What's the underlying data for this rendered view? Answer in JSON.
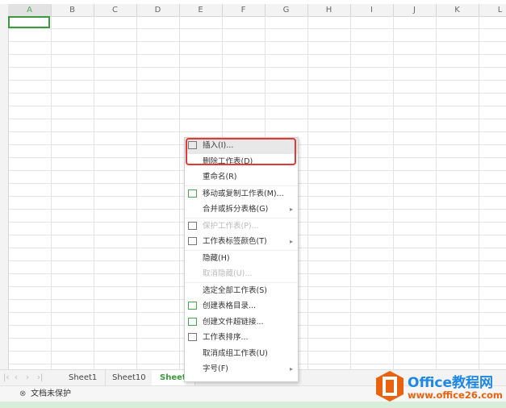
{
  "columns": [
    "A",
    "B",
    "C",
    "D",
    "E",
    "F",
    "G",
    "H",
    "I",
    "J",
    "K",
    "L"
  ],
  "sheet_tabs": [
    "Sheet1",
    "Sheet10",
    "Sheet"
  ],
  "status": {
    "protect_label": "文档未保护"
  },
  "context_menu": [
    {
      "label": "插入(I)...",
      "icon": "insert-table-icon",
      "state": "highlighted"
    },
    {
      "label": "删除工作表(D)",
      "icon": null
    },
    {
      "label": "重命名(R)",
      "icon": null
    },
    {
      "label": "移动或复制工作表(M)...",
      "icon": "move-copy-icon",
      "sep": true
    },
    {
      "label": "合并或拆分表格(G)",
      "icon": null,
      "submenu": true
    },
    {
      "label": "保护工作表(P)...",
      "icon": "protect-icon",
      "disabled": true,
      "sep": true
    },
    {
      "label": "工作表标签颜色(T)",
      "icon": "tab-color-icon",
      "submenu": true
    },
    {
      "label": "隐藏(H)",
      "icon": null,
      "sep": true
    },
    {
      "label": "取消隐藏(U)...",
      "icon": null,
      "disabled": true
    },
    {
      "label": "选定全部工作表(S)",
      "icon": null,
      "sep": true
    },
    {
      "label": "创建表格目录...",
      "icon": "catalog-icon"
    },
    {
      "label": "创建文件超链接...",
      "icon": "hyperlink-icon"
    },
    {
      "label": "工作表排序...",
      "icon": "sort-icon"
    },
    {
      "label": "取消成组工作表(U)",
      "icon": null
    },
    {
      "label": "字号(F)",
      "icon": null,
      "submenu": true
    }
  ],
  "watermark": {
    "brand": "Office教程网",
    "url": "www.office26.com"
  },
  "colors": {
    "accent": "#3c9a3c",
    "highlight_box": "#e53935",
    "logo": "#e8620f",
    "logo_text": "#1e88e5"
  }
}
